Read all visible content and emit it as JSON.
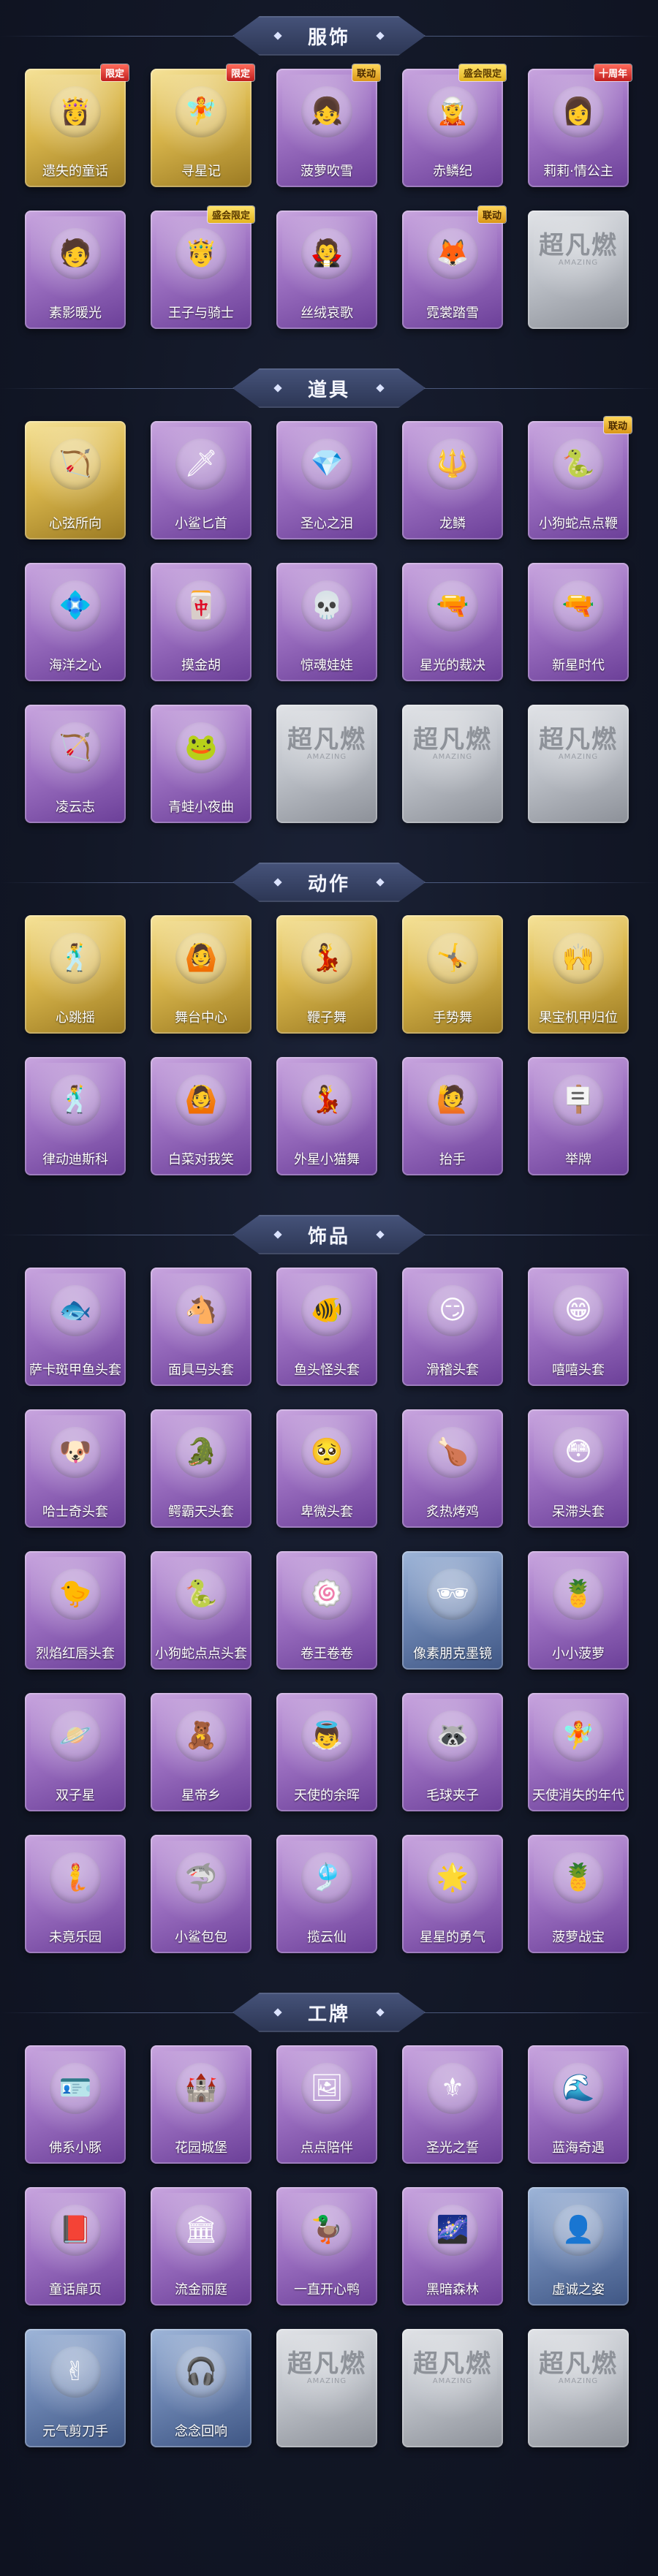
{
  "sections": [
    {
      "title": "服饰",
      "items": [
        {
          "label": "遗失的童话",
          "rarity": "gold",
          "icon": "👸",
          "badge": "限定",
          "badge_style": "lg"
        },
        {
          "label": "寻星记",
          "rarity": "gold",
          "icon": "🧚",
          "badge": "限定",
          "badge_style": "lg"
        },
        {
          "label": "菠萝吹雪",
          "rarity": "purple",
          "icon": "👧",
          "badge": "联动",
          "badge_style": "gold"
        },
        {
          "label": "赤鳞纪",
          "rarity": "purple",
          "icon": "🧝",
          "badge": "盛会限定",
          "badge_style": "yellow"
        },
        {
          "label": "莉莉·情公主",
          "rarity": "purple",
          "icon": "👩",
          "badge": "十周年",
          "badge_style": "lg"
        },
        {
          "label": "素影暖光",
          "rarity": "purple",
          "icon": "🧑",
          "badge": "",
          "badge_style": ""
        },
        {
          "label": "王子与骑士",
          "rarity": "purple",
          "icon": "🤴",
          "badge": "盛会限定",
          "badge_style": "yellow"
        },
        {
          "label": "丝绒哀歌",
          "rarity": "purple",
          "icon": "🧛",
          "badge": "",
          "badge_style": ""
        },
        {
          "label": "霓裳踏雪",
          "rarity": "purple",
          "icon": "🦊",
          "badge": "联动",
          "badge_style": "gold"
        },
        {
          "label": "",
          "rarity": "gray",
          "icon": "",
          "badge": "",
          "badge_style": "",
          "placeholder": "超凡燃",
          "placeholder_sub": "AMAZING"
        }
      ]
    },
    {
      "title": "道具",
      "items": [
        {
          "label": "心弦所向",
          "rarity": "gold",
          "icon": "🏹",
          "badge": "",
          "badge_style": ""
        },
        {
          "label": "小鲨匕首",
          "rarity": "purple",
          "icon": "🗡",
          "badge": "",
          "badge_style": ""
        },
        {
          "label": "圣心之泪",
          "rarity": "purple",
          "icon": "💎",
          "badge": "",
          "badge_style": ""
        },
        {
          "label": "龙鳞",
          "rarity": "purple",
          "icon": "🔱",
          "badge": "",
          "badge_style": ""
        },
        {
          "label": "小狗蛇点点鞭",
          "rarity": "purple",
          "icon": "🐍",
          "badge": "联动",
          "badge_style": "gold"
        },
        {
          "label": "海洋之心",
          "rarity": "purple",
          "icon": "💠",
          "badge": "",
          "badge_style": ""
        },
        {
          "label": "摸金胡",
          "rarity": "purple",
          "icon": "🀄",
          "badge": "",
          "badge_style": ""
        },
        {
          "label": "惊魂娃娃",
          "rarity": "purple",
          "icon": "💀",
          "badge": "",
          "badge_style": ""
        },
        {
          "label": "星光的裁决",
          "rarity": "purple",
          "icon": "🔫",
          "badge": "",
          "badge_style": ""
        },
        {
          "label": "新星时代",
          "rarity": "purple",
          "icon": "🔫",
          "badge": "",
          "badge_style": ""
        },
        {
          "label": "凌云志",
          "rarity": "purple",
          "icon": "🏹",
          "badge": "",
          "badge_style": ""
        },
        {
          "label": "青蛙小夜曲",
          "rarity": "purple",
          "icon": "🐸",
          "badge": "",
          "badge_style": ""
        },
        {
          "label": "",
          "rarity": "gray",
          "icon": "",
          "badge": "",
          "badge_style": "",
          "placeholder": "超凡燃",
          "placeholder_sub": "AMAZING"
        },
        {
          "label": "",
          "rarity": "gray",
          "icon": "",
          "badge": "",
          "badge_style": "",
          "placeholder": "超凡燃",
          "placeholder_sub": "AMAZING"
        },
        {
          "label": "",
          "rarity": "gray",
          "icon": "",
          "badge": "",
          "badge_style": "",
          "placeholder": "超凡燃",
          "placeholder_sub": "AMAZING"
        }
      ]
    },
    {
      "title": "动作",
      "items": [
        {
          "label": "心跳摇",
          "rarity": "gold",
          "icon": "🕺",
          "badge": "",
          "badge_style": ""
        },
        {
          "label": "舞台中心",
          "rarity": "gold",
          "icon": "🙆",
          "badge": "",
          "badge_style": ""
        },
        {
          "label": "鞭子舞",
          "rarity": "gold",
          "icon": "💃",
          "badge": "",
          "badge_style": ""
        },
        {
          "label": "手势舞",
          "rarity": "gold",
          "icon": "🤸",
          "badge": "",
          "badge_style": ""
        },
        {
          "label": "果宝机甲归位",
          "rarity": "gold",
          "icon": "🙌",
          "badge": "",
          "badge_style": ""
        },
        {
          "label": "律动迪斯科",
          "rarity": "purple",
          "icon": "🕺",
          "badge": "",
          "badge_style": ""
        },
        {
          "label": "白菜对我笑",
          "rarity": "purple",
          "icon": "🙆",
          "badge": "",
          "badge_style": ""
        },
        {
          "label": "外星小猫舞",
          "rarity": "purple",
          "icon": "💃",
          "badge": "",
          "badge_style": ""
        },
        {
          "label": "抬手",
          "rarity": "purple",
          "icon": "🙋",
          "badge": "",
          "badge_style": ""
        },
        {
          "label": "举牌",
          "rarity": "purple",
          "icon": "🪧",
          "badge": "",
          "badge_style": ""
        }
      ]
    },
    {
      "title": "饰品",
      "items": [
        {
          "label": "萨卡斑甲鱼头套",
          "rarity": "purple",
          "icon": "🐟",
          "badge": "",
          "badge_style": ""
        },
        {
          "label": "面具马头套",
          "rarity": "purple",
          "icon": "🐴",
          "badge": "",
          "badge_style": ""
        },
        {
          "label": "鱼头怪头套",
          "rarity": "purple",
          "icon": "🐠",
          "badge": "",
          "badge_style": ""
        },
        {
          "label": "滑稽头套",
          "rarity": "purple",
          "icon": "😏",
          "badge": "",
          "badge_style": ""
        },
        {
          "label": "嘻嘻头套",
          "rarity": "purple",
          "icon": "😁",
          "badge": "",
          "badge_style": ""
        },
        {
          "label": "哈士奇头套",
          "rarity": "purple",
          "icon": "🐶",
          "badge": "",
          "badge_style": ""
        },
        {
          "label": "鳄霸天头套",
          "rarity": "purple",
          "icon": "🐊",
          "badge": "",
          "badge_style": ""
        },
        {
          "label": "卑微头套",
          "rarity": "purple",
          "icon": "🥺",
          "badge": "",
          "badge_style": ""
        },
        {
          "label": "炙热烤鸡",
          "rarity": "purple",
          "icon": "🍗",
          "badge": "",
          "badge_style": ""
        },
        {
          "label": "呆滞头套",
          "rarity": "purple",
          "icon": "😳",
          "badge": "",
          "badge_style": ""
        },
        {
          "label": "烈焰红唇头套",
          "rarity": "purple",
          "icon": "🐤",
          "badge": "",
          "badge_style": ""
        },
        {
          "label": "小狗蛇点点头套",
          "rarity": "purple",
          "icon": "🐍",
          "badge": "",
          "badge_style": ""
        },
        {
          "label": "卷王卷卷",
          "rarity": "purple",
          "icon": "🍥",
          "badge": "",
          "badge_style": ""
        },
        {
          "label": "像素朋克墨镜",
          "rarity": "blue",
          "icon": "🕶",
          "badge": "",
          "badge_style": ""
        },
        {
          "label": "小小菠萝",
          "rarity": "purple",
          "icon": "🍍",
          "badge": "",
          "badge_style": ""
        },
        {
          "label": "双子星",
          "rarity": "purple",
          "icon": "🪐",
          "badge": "",
          "badge_style": ""
        },
        {
          "label": "星帝乡",
          "rarity": "purple",
          "icon": "🧸",
          "badge": "",
          "badge_style": ""
        },
        {
          "label": "天使的余晖",
          "rarity": "purple",
          "icon": "👼",
          "badge": "",
          "badge_style": ""
        },
        {
          "label": "毛球夹子",
          "rarity": "purple",
          "icon": "🦝",
          "badge": "",
          "badge_style": ""
        },
        {
          "label": "天使消失的年代",
          "rarity": "purple",
          "icon": "🧚",
          "badge": "",
          "badge_style": ""
        },
        {
          "label": "未竟乐园",
          "rarity": "purple",
          "icon": "🧜",
          "badge": "",
          "badge_style": ""
        },
        {
          "label": "小鲨包包",
          "rarity": "purple",
          "icon": "🦈",
          "badge": "",
          "badge_style": ""
        },
        {
          "label": "揽云仙",
          "rarity": "purple",
          "icon": "🎐",
          "badge": "",
          "badge_style": ""
        },
        {
          "label": "星星的勇气",
          "rarity": "purple",
          "icon": "🌟",
          "badge": "",
          "badge_style": ""
        },
        {
          "label": "菠萝战宝",
          "rarity": "purple",
          "icon": "🍍",
          "badge": "",
          "badge_style": ""
        }
      ]
    },
    {
      "title": "工牌",
      "items": [
        {
          "label": "佛系小豚",
          "rarity": "purple",
          "icon": "🪪",
          "badge": "",
          "badge_style": ""
        },
        {
          "label": "花园城堡",
          "rarity": "purple",
          "icon": "🏰",
          "badge": "",
          "badge_style": ""
        },
        {
          "label": "点点陪伴",
          "rarity": "purple",
          "icon": "🖼",
          "badge": "",
          "badge_style": ""
        },
        {
          "label": "圣光之誓",
          "rarity": "purple",
          "icon": "⚜",
          "badge": "",
          "badge_style": ""
        },
        {
          "label": "蓝海奇遇",
          "rarity": "purple",
          "icon": "🌊",
          "badge": "",
          "badge_style": ""
        },
        {
          "label": "童话扉页",
          "rarity": "purple",
          "icon": "📕",
          "badge": "",
          "badge_style": ""
        },
        {
          "label": "流金丽庭",
          "rarity": "purple",
          "icon": "🏛",
          "badge": "",
          "badge_style": ""
        },
        {
          "label": "一直开心鸭",
          "rarity": "purple",
          "icon": "🦆",
          "badge": "",
          "badge_style": ""
        },
        {
          "label": "黑暗森林",
          "rarity": "purple",
          "icon": "🌌",
          "badge": "",
          "badge_style": ""
        },
        {
          "label": "虚诚之姿",
          "rarity": "blue",
          "icon": "👤",
          "badge": "",
          "badge_style": ""
        },
        {
          "label": "元气剪刀手",
          "rarity": "blue",
          "icon": "✌",
          "badge": "",
          "badge_style": ""
        },
        {
          "label": "念念回响",
          "rarity": "blue",
          "icon": "🎧",
          "badge": "",
          "badge_style": ""
        },
        {
          "label": "",
          "rarity": "gray",
          "icon": "",
          "badge": "",
          "badge_style": "",
          "placeholder": "超凡燃",
          "placeholder_sub": "AMAZING"
        },
        {
          "label": "",
          "rarity": "gray",
          "icon": "",
          "badge": "",
          "badge_style": "",
          "placeholder": "超凡燃",
          "placeholder_sub": "AMAZING"
        },
        {
          "label": "",
          "rarity": "gray",
          "icon": "",
          "badge": "",
          "badge_style": "",
          "placeholder": "超凡燃",
          "placeholder_sub": "AMAZING"
        }
      ]
    }
  ]
}
